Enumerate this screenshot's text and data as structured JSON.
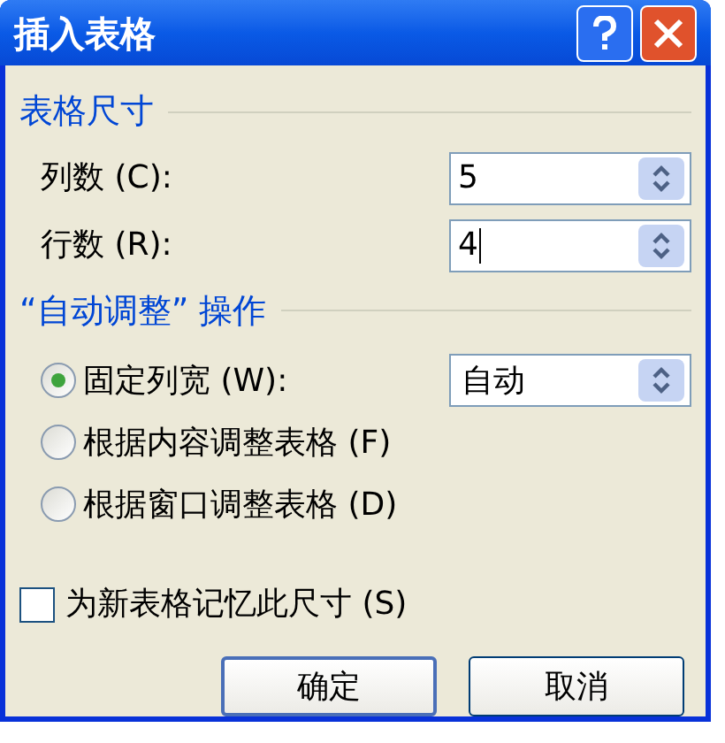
{
  "window": {
    "title": "插入表格"
  },
  "size_group": {
    "title": "表格尺寸",
    "fields": [
      {
        "label": "列数 (C):",
        "value": "5",
        "focused": false
      },
      {
        "label": "行数 (R):",
        "value": "4",
        "focused": true
      }
    ]
  },
  "autofit_group": {
    "title": "“自动调整” 操作",
    "options": [
      {
        "label": "固定列宽 (W):",
        "selected": true,
        "dropdown": {
          "value": "自动"
        }
      },
      {
        "label": "根据内容调整表格 (F)",
        "selected": false
      },
      {
        "label": "根据窗口调整表格 (D)",
        "selected": false
      }
    ]
  },
  "remember": {
    "label": "为新表格记忆此尺寸 (S)",
    "checked": false
  },
  "buttons": [
    {
      "label": "确定",
      "default": true
    },
    {
      "label": "取消",
      "default": false
    }
  ]
}
